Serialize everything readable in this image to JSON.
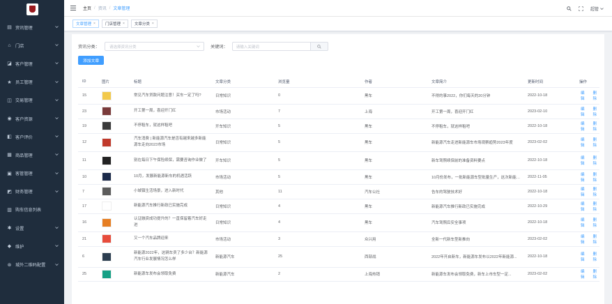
{
  "sidebar": {
    "items": [
      {
        "label": "资讯管理",
        "icon": "document-icon"
      },
      {
        "label": "门店",
        "icon": "store-icon"
      },
      {
        "label": "客户管理",
        "icon": "customer-icon"
      },
      {
        "label": "员工管理",
        "icon": "star-icon"
      },
      {
        "label": "交易管理",
        "icon": "trade-icon"
      },
      {
        "label": "客户资源",
        "icon": "resource-icon"
      },
      {
        "label": "客户评价",
        "icon": "review-icon"
      },
      {
        "label": "商品管理",
        "icon": "goods-icon"
      },
      {
        "label": "客管管理",
        "icon": "manage-icon"
      },
      {
        "label": "财务管理",
        "icon": "finance-icon"
      },
      {
        "label": "购车信息列表",
        "icon": "list-icon"
      },
      {
        "label": "设置",
        "icon": "gear-icon"
      },
      {
        "label": "维护",
        "icon": "shield-icon"
      },
      {
        "label": "城外二维码配置",
        "icon": "qrcode-icon"
      }
    ]
  },
  "breadcrumb": [
    "主页",
    "资讯",
    "文章管理"
  ],
  "header": {
    "user": "超管"
  },
  "tags": [
    {
      "label": "文章管理",
      "active": true
    },
    {
      "label": "门店管理",
      "active": false
    },
    {
      "label": "文章分类",
      "active": false
    }
  ],
  "filter": {
    "category_label": "资讯分类：",
    "category_placeholder": "请选择资讯分类",
    "keyword_label": "关键词：",
    "keyword_placeholder": "请输入关键词"
  },
  "add_button": "添加文章",
  "table": {
    "headers": [
      "ID",
      "图片",
      "标题",
      "文章分类",
      "浏览量",
      "作者",
      "文章简介",
      "更新时间",
      "操作"
    ],
    "edit_label": "编辑",
    "delete_label": "删除",
    "rows": [
      {
        "id": "15",
        "thumb": "#f2c94c",
        "title": "常见汽车贷款问题注意！买车一定了吗?",
        "category": "日常知识",
        "views": "0",
        "author": "黑车",
        "intro": "不得的事2022，你们每天的20分钟",
        "time": "2022-10-18"
      },
      {
        "id": "23",
        "thumb": "#7a3b3b",
        "title": "开工第一周，喜迎开门红",
        "category": "市场活动",
        "views": "7",
        "author": "上海",
        "intro": "开工第一周，喜迎开门红",
        "time": "2023-02-10"
      },
      {
        "id": "19",
        "thumb": "#3a3a3a",
        "title": "不停租车，就这样租吧",
        "category": "开车知识",
        "views": "5",
        "author": "黑车",
        "intro": "不停租车，就这样租吧",
        "time": "2022-10-18"
      },
      {
        "id": "12",
        "thumb": "#c0392b",
        "title": "汽车消费 | 新能源汽车是否有越来越多新能源车走向2023市场",
        "category": "日常知识",
        "views": "5",
        "author": "黑车",
        "intro": "新能源汽车走进新能源车市场观察趋势2023年度",
        "time": "2023-02-02"
      },
      {
        "id": "11",
        "thumb": "#222222",
        "title": "别在每日下午保险续保，需要咨询作业做了",
        "category": "开车知识",
        "views": "5",
        "author": "黑车",
        "intro": "新车驾照续保前的准备资料要点",
        "time": "2022-10-18"
      },
      {
        "id": "10",
        "thumb": "#1b2a4a",
        "title": "10月，发展新能源新车的机遇活跃",
        "category": "市场活动",
        "views": "5",
        "author": "黑车",
        "intro": "10月份发布，一批新能源车型批量生产，这次新能源车...",
        "time": "2022-11-05"
      },
      {
        "id": "7",
        "thumb": "#5c5c5c",
        "title": "小城镇生活场景，进入新时代",
        "category": "其他",
        "views": "11",
        "author": "汽车公社",
        "intro": "告车的驾驶技术好",
        "time": "2022-10-18"
      },
      {
        "id": "17",
        "thumb": "#ffffff",
        "title": "新能源汽车推行新政已实施完成",
        "category": "日常知识",
        "views": "4",
        "author": "黑车",
        "intro": "新能源汽车推行新政已实施完成",
        "time": "2022-10-29"
      },
      {
        "id": "16",
        "thumb": "#e67e22",
        "title": "认证融资成功提升的？一直保留着汽车好走进",
        "category": "日常知识",
        "views": "4",
        "author": "黑车",
        "intro": "汽车驾照后安全事项",
        "time": "2022-10-18"
      },
      {
        "id": "21",
        "thumb": "#e74c3c",
        "title": "又一个汽车品牌迎来",
        "category": "市场活动",
        "views": "3",
        "author": "众兴用",
        "intro": "全新一代新车型新推向",
        "time": "2023-02-02"
      },
      {
        "id": "6",
        "thumb": "#2c3e50",
        "title": "新能源2022年，这辆车卖了多少台？新能源汽车行业发展情况怎么样",
        "category": "新能源汽车",
        "views": "25",
        "author": "西部战",
        "intro": "2022年开启新车，新能源车发布以2022年新能源...",
        "time": "2022-10-18"
      },
      {
        "id": "25",
        "thumb": "#16a085",
        "title": "新能源车发布会领取免费",
        "category": "新能源汽车",
        "views": "2",
        "author": "上海热销",
        "intro": "新能源车发布会领取免费，新车上市车型一定...",
        "time": "2023-02-02"
      }
    ]
  }
}
